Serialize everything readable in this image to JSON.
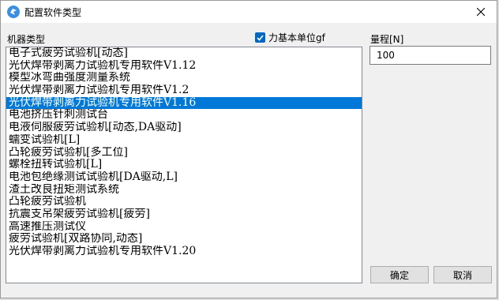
{
  "window": {
    "title": "配置软件类型"
  },
  "labels": {
    "machine_type": "机器类型",
    "range": "量程[N]",
    "force_unit_checkbox": "力基本单位gf"
  },
  "force_unit_checked": true,
  "range_value": "100",
  "machine_list": {
    "items": [
      "电子式疲劳试验机[动态]",
      "光伏焊带剥离力试验机专用软件V1.12",
      "模型冰弯曲强度测量系统",
      "光伏焊带剥离力试验机专用软件V1.2",
      "光伏焊带剥离力试验机专用软件V1.16",
      "电池挤压针刺测试台",
      "电液伺服疲劳试验机[动态,DA驱动]",
      "蠕变试验机[L]",
      "凸轮疲劳试验机[多工位]",
      "螺栓扭转试验机[L]",
      "电池包绝缘测试试验机[DA驱动,L]",
      "渣土改良扭矩测试系统",
      "凸轮疲劳试验机",
      "抗震支吊架疲劳试验机[疲劳]",
      "高速推压测试仪",
      "疲劳试验机[双路协同,动态]",
      "光伏焊带剥离力试验机专用软件V1.20"
    ],
    "selected_index": 4
  },
  "buttons": {
    "ok": "确定",
    "cancel": "取消"
  },
  "colors": {
    "selection": "#0078d7",
    "checkbox_accent": "#0067c0",
    "app_icon": "#3b8fe0"
  },
  "icons": {
    "app": "app-logo-icon",
    "close": "close-icon",
    "checkmark": "checkmark-icon"
  }
}
